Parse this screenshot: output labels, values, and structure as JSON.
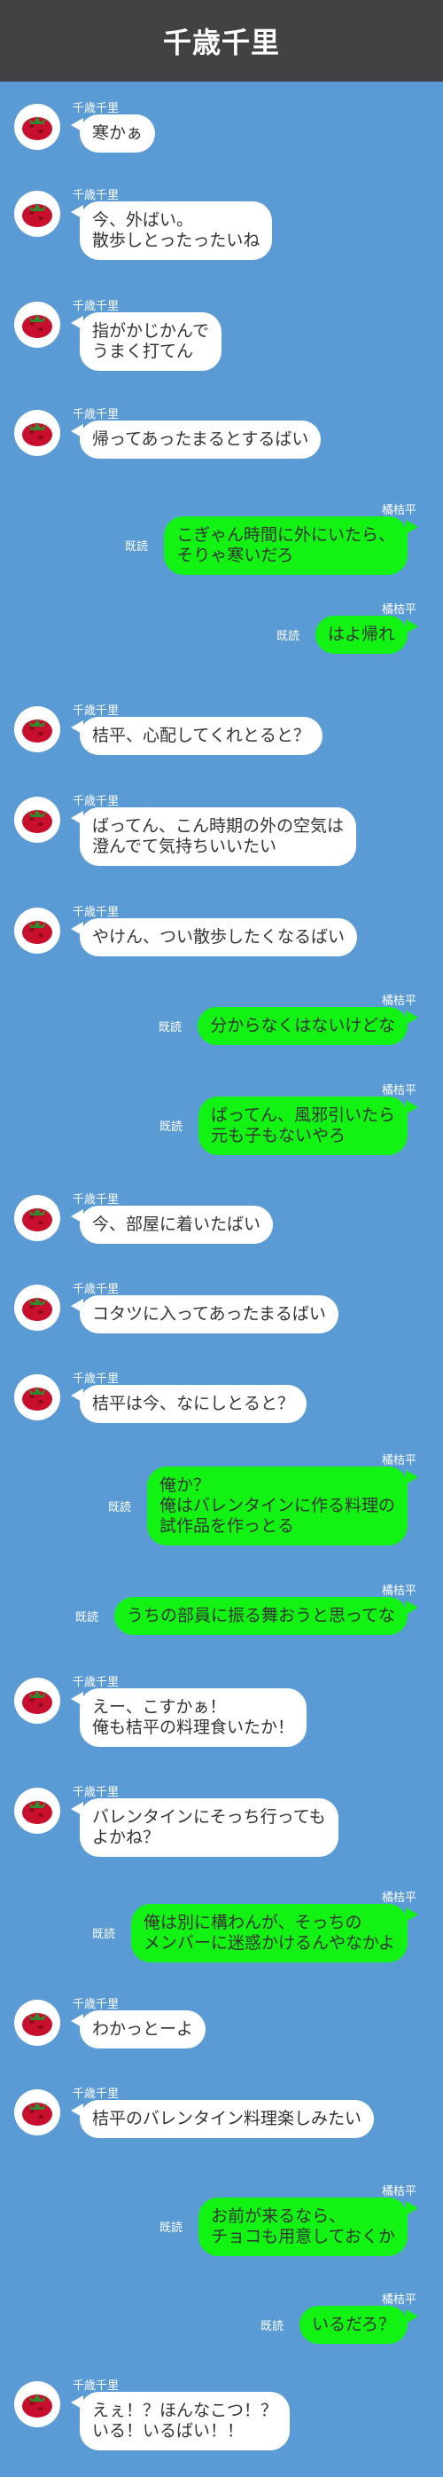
{
  "header": {
    "title": "千歳千里"
  },
  "colors": {
    "background": "#5b9bd5",
    "header": "#424244",
    "incoming": "#ffffff",
    "outgoing": "#13f313"
  },
  "avatar_icon": "strawberry-icon",
  "messages": [
    {
      "side": "left",
      "sender": "千歳千里",
      "text": "寒かぁ"
    },
    {
      "side": "left",
      "sender": "千歳千里",
      "text": "今、外ばい。\n散歩しとったったいね"
    },
    {
      "side": "left",
      "sender": "千歳千里",
      "text": "指がかじかんで\nうまく打てん"
    },
    {
      "side": "left",
      "sender": "千歳千里",
      "text": "帰ってあったまるとするばい"
    },
    {
      "side": "right",
      "sender": "橘桔平",
      "read": "既読",
      "text": "こぎゃん時間に外にいたら、\nそりゃ寒いだろ"
    },
    {
      "side": "right",
      "sender": "橘桔平",
      "read": "既読",
      "text": "はよ帰れ"
    },
    {
      "side": "left",
      "sender": "千歳千里",
      "text": "桔平、心配してくれとると？"
    },
    {
      "side": "left",
      "sender": "千歳千里",
      "text": "ばってん、こん時期の外の空気は\n澄んでて気持ちいいたい"
    },
    {
      "side": "left",
      "sender": "千歳千里",
      "text": "やけん、つい散歩したくなるばい"
    },
    {
      "side": "right",
      "sender": "橘桔平",
      "read": "既読",
      "text": "分からなくはないけどな"
    },
    {
      "side": "right",
      "sender": "橘桔平",
      "read": "既読",
      "text": "ばってん、風邪引いたら\n元も子もないやろ"
    },
    {
      "side": "left",
      "sender": "千歳千里",
      "text": "今、部屋に着いたばい"
    },
    {
      "side": "left",
      "sender": "千歳千里",
      "text": "コタツに入ってあったまるばい"
    },
    {
      "side": "left",
      "sender": "千歳千里",
      "text": "桔平は今、なにしとると？"
    },
    {
      "side": "right",
      "sender": "橘桔平",
      "read": "既読",
      "text": "俺か？\n俺はバレンタインに作る料理の\n試作品を作っとる"
    },
    {
      "side": "right",
      "sender": "橘桔平",
      "read": "既読",
      "text": "うちの部員に振る舞おうと思ってな"
    },
    {
      "side": "left",
      "sender": "千歳千里",
      "text": "えー、こすかぁ！\n俺も桔平の料理食いたか！"
    },
    {
      "side": "left",
      "sender": "千歳千里",
      "text": "バレンタインにそっち行っても\nよかね？"
    },
    {
      "side": "right",
      "sender": "橘桔平",
      "read": "既読",
      "text": "俺は別に構わんが、そっちの\nメンバーに迷惑かけるんやなかよ"
    },
    {
      "side": "left",
      "sender": "千歳千里",
      "text": "わかっとーよ"
    },
    {
      "side": "left",
      "sender": "千歳千里",
      "text": "桔平のバレンタイン料理楽しみたい"
    },
    {
      "side": "right",
      "sender": "橘桔平",
      "read": "既読",
      "text": "お前が来るなら、\nチョコも用意しておくか"
    },
    {
      "side": "right",
      "sender": "橘桔平",
      "read": "既読",
      "text": "いるだろ？"
    },
    {
      "side": "left",
      "sender": "千歳千里",
      "text": "えぇ！？ほんなこつ！？\nいる！いるばい！！"
    }
  ]
}
